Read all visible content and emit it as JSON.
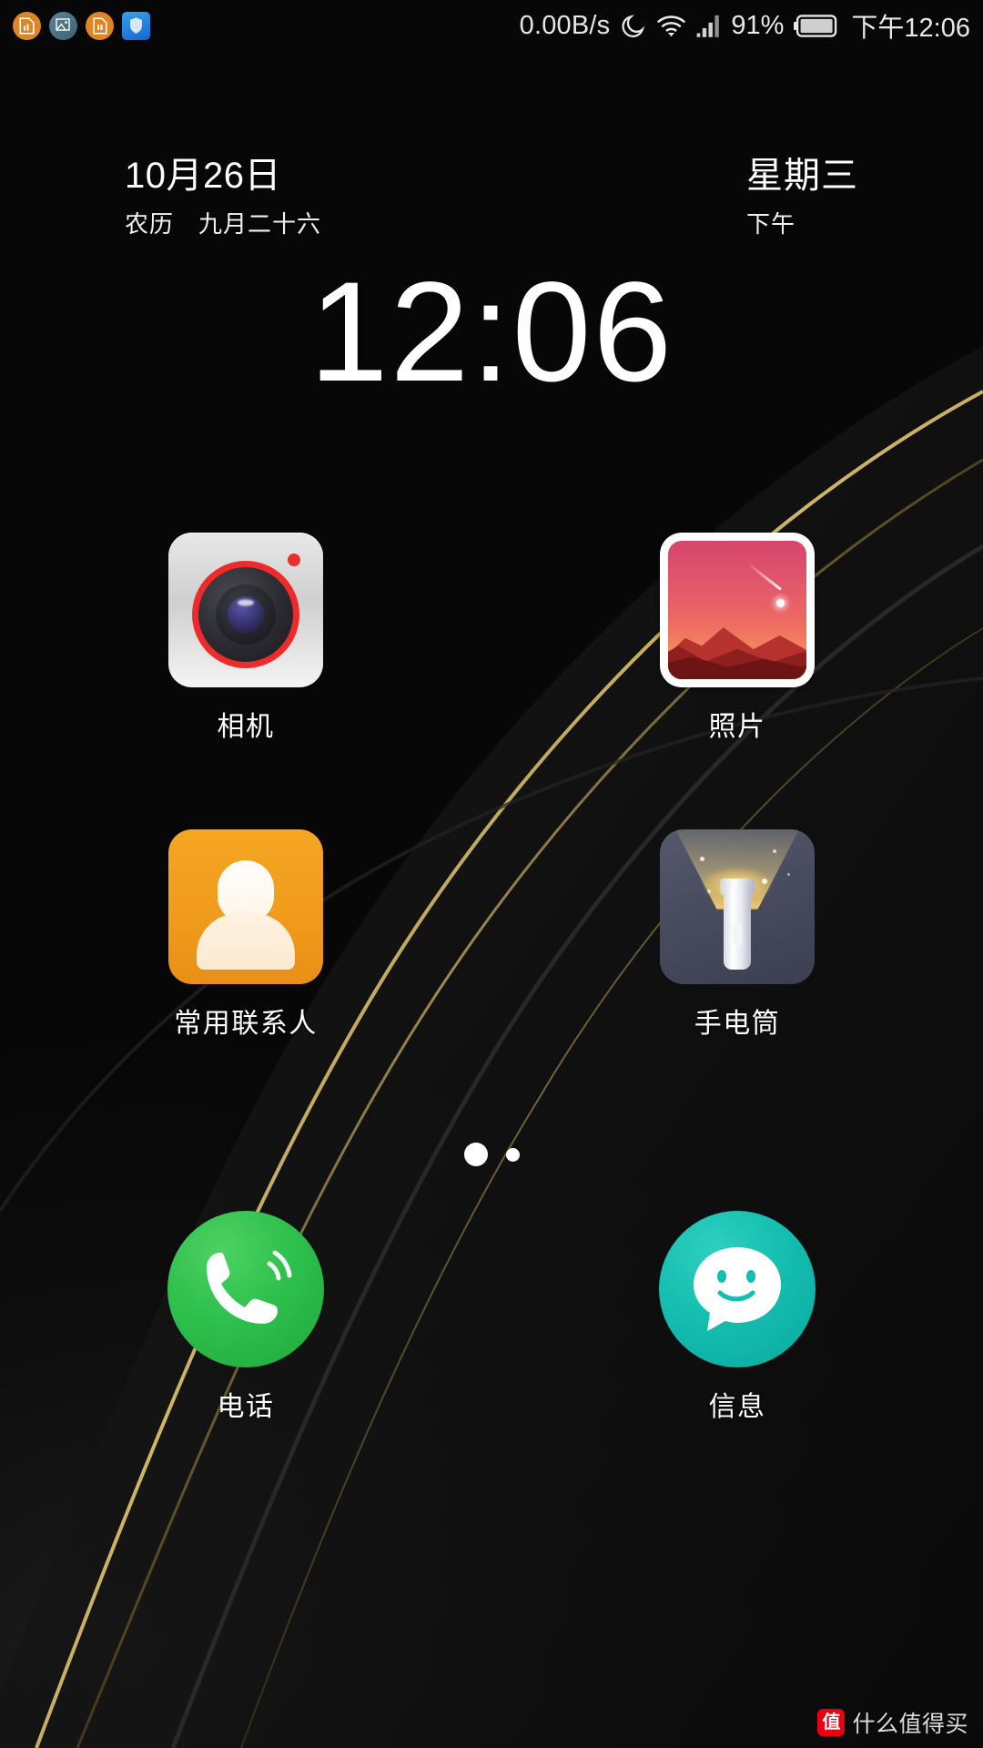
{
  "statusbar": {
    "left_icons": [
      {
        "name": "sim-card-orange-icon",
        "glyph": "▤",
        "bg": "#e08524"
      },
      {
        "name": "gallery-teal-icon",
        "glyph": "▣",
        "bg": "#4a7487"
      },
      {
        "name": "sim-card-orange-2-icon",
        "glyph": "▥",
        "bg": "#e08524"
      },
      {
        "name": "security-shield-icon",
        "glyph": "⛨",
        "bg": "#2b8de0"
      }
    ],
    "network_speed": "0.00B/s",
    "do_not_disturb_icon": "moon-icon",
    "wifi_icon": "wifi-icon",
    "signal_icon": "signal-bars-icon",
    "battery_percent": "91%",
    "battery_icon": "battery-full-icon",
    "clock": "下午12:06"
  },
  "clock_widget": {
    "date": "10月26日",
    "lunar": "农历　九月二十六",
    "weekday": "星期三",
    "period": "下午",
    "time": "12:06"
  },
  "apps": [
    [
      {
        "label": "相机",
        "icon": "camera-icon",
        "accent": "#ee2b2b"
      },
      {
        "label": "照片",
        "icon": "photos-icon",
        "accent": "#e0556c"
      }
    ],
    [
      {
        "label": "常用联系人",
        "icon": "contacts-icon",
        "accent": "#f5a623"
      },
      {
        "label": "手电筒",
        "icon": "flashlight-icon",
        "accent": "#484c5e"
      }
    ]
  ],
  "page_indicator": {
    "total": 2,
    "current": 1
  },
  "dock": [
    {
      "label": "电话",
      "icon": "phone-icon",
      "accent": "#2ec04c"
    },
    {
      "label": "信息",
      "icon": "message-icon",
      "accent": "#14beb0"
    }
  ],
  "watermark": {
    "badge": "值",
    "text": "什么值得买"
  }
}
